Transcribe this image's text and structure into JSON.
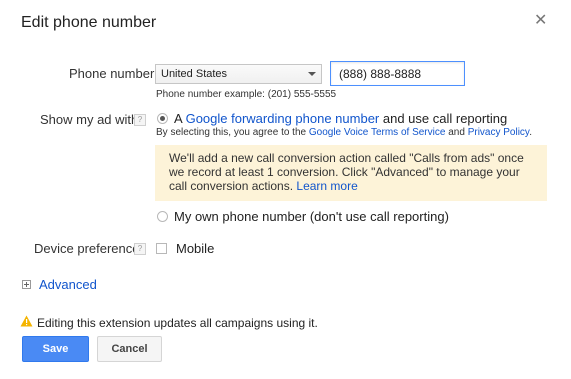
{
  "dialog": {
    "title": "Edit phone number",
    "close_glyph": "✕"
  },
  "phone": {
    "label": "Phone number",
    "country": "United States",
    "number": "(888) 888-8888",
    "example": "Phone number example: (201) 555-5555"
  },
  "show_ad": {
    "label": "Show my ad with",
    "help": "?",
    "option1": {
      "prefix": "A ",
      "link": "Google forwarding phone number",
      "suffix": " and use call reporting",
      "selected": true
    },
    "consent": {
      "prefix": "By selecting this, you agree to the ",
      "link1": "Google Voice Terms of Service",
      "middle": " and ",
      "link2": "Privacy Policy",
      "suffix": "."
    },
    "info": {
      "text": "We'll add a new call conversion action called \"Calls from ads\" once we record at least 1 conversion. Click \"Advanced\" to manage your call conversion actions. ",
      "link": "Learn more"
    },
    "option2": {
      "label": "My own phone number (don't use call reporting)",
      "selected": false
    }
  },
  "device": {
    "label": "Device preference",
    "help": "?",
    "checkbox_label": "Mobile",
    "checked": false
  },
  "advanced": {
    "label": "Advanced"
  },
  "warning": {
    "text": "Editing this extension updates all campaigns using it."
  },
  "buttons": {
    "save": "Save",
    "cancel": "Cancel"
  },
  "colors": {
    "accent": "#4a8af4",
    "link": "#1155cc",
    "info_bg": "#fdf3d8",
    "warning": "#f4b400"
  }
}
